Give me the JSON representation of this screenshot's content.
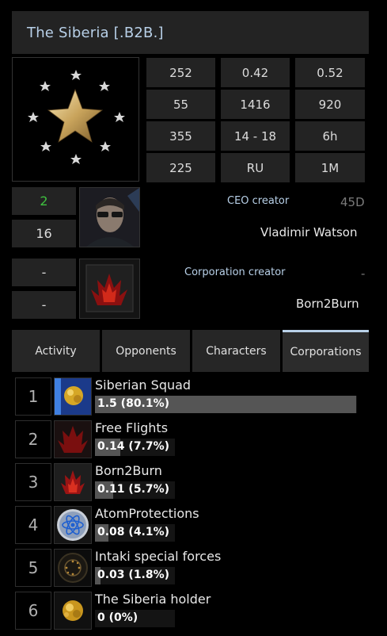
{
  "header": {
    "title": "The Siberia [.B2B.]"
  },
  "stats": [
    [
      "252",
      "0.42",
      "0.52"
    ],
    [
      "55",
      "1416",
      "920"
    ],
    [
      "355",
      "14 - 18",
      "6h"
    ],
    [
      "225",
      "RU",
      "1M"
    ]
  ],
  "ceo": {
    "count_top": "2",
    "count_top_color": "#3fc03f",
    "count_bottom": "16",
    "label": "CEO creator",
    "age": "45D",
    "name": "Vladimir Watson"
  },
  "corp": {
    "top": "-",
    "bottom": "-",
    "label": "Corporation creator",
    "value": "-",
    "name": "Born2Burn"
  },
  "tabs": [
    "Activity",
    "Opponents",
    "Characters",
    "Corporations"
  ],
  "active_tab": "Corporations",
  "corporations": [
    {
      "rank": "1",
      "name": "Siberian Squad",
      "value": "1.5 (80.1%)",
      "share": 0.801,
      "icon": "gold-emblem-icon"
    },
    {
      "rank": "2",
      "name": "Free Flights",
      "value": "0.14 (7.7%)",
      "share": 0.077,
      "icon": "red-flame-icon"
    },
    {
      "rank": "3",
      "name": "Born2Burn",
      "value": "0.11 (5.7%)",
      "share": 0.057,
      "icon": "red-flame-icon"
    },
    {
      "rank": "4",
      "name": "AtomProtections",
      "value": "0.08 (4.1%)",
      "share": 0.041,
      "icon": "atom-icon"
    },
    {
      "rank": "5",
      "name": "Intaki special forces",
      "value": "0.03 (1.8%)",
      "share": 0.018,
      "icon": "gear-ring-icon"
    },
    {
      "rank": "6",
      "name": "The Siberia holder",
      "value": "0 (0%)",
      "share": 0.0,
      "icon": "gold-emblem-icon"
    }
  ]
}
